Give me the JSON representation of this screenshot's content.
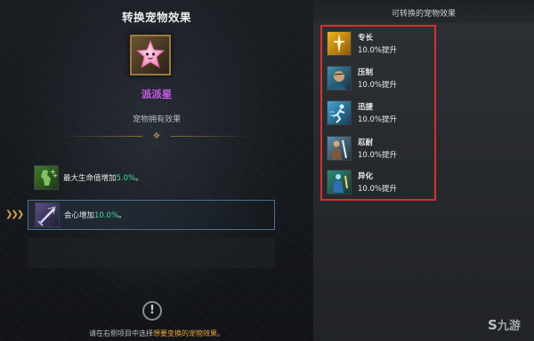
{
  "left_panel": {
    "title": "转换宠物效果",
    "pet_name": "派派星",
    "pet_subtitle": "宠物拥有效果",
    "effects": [
      {
        "icon": "hp-buff-icon",
        "label": "最大生命值增加",
        "value": "5.0%",
        "suffix": "。"
      },
      {
        "icon": "crit-sword-icon",
        "label": "会心增加",
        "value": "10.0%",
        "suffix": "。"
      }
    ],
    "hint_prefix": "请在右侧项目中选择",
    "hint_highlight": "想要变换的宠物效果",
    "hint_suffix": "。"
  },
  "right_panel": {
    "title": "可转换的宠物效果",
    "options": [
      {
        "name": "专长",
        "value": "10.0%提升",
        "icon": "expertise-icon"
      },
      {
        "name": "压制",
        "value": "10.0%提升",
        "icon": "suppress-icon"
      },
      {
        "name": "迅捷",
        "value": "10.0%提升",
        "icon": "swift-icon"
      },
      {
        "name": "忍耐",
        "value": "10.0%提升",
        "icon": "endurance-icon"
      },
      {
        "name": "异化",
        "value": "10.0%提升",
        "icon": "mutation-icon"
      }
    ]
  },
  "colors": {
    "pet_name": "#cf5cf0",
    "effect_value": "#3ee0a0",
    "highlight": "#e6a53a",
    "selection_box": "#d8302d"
  },
  "watermark": "九游"
}
